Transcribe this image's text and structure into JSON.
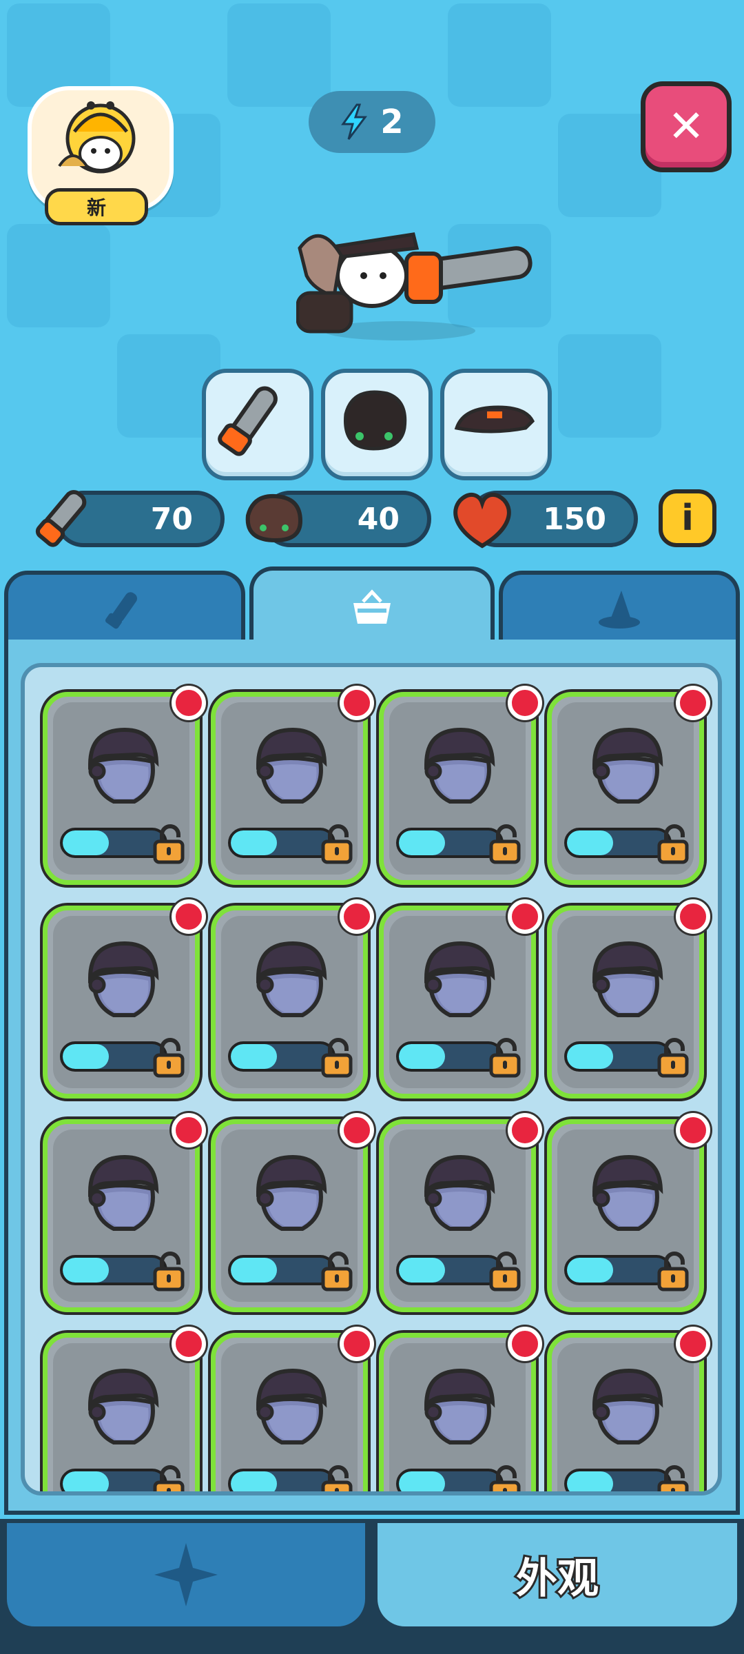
{
  "header": {
    "avatar_badge": "新",
    "energy_count": "2"
  },
  "stats": {
    "attack": "70",
    "defense": "40",
    "health": "150"
  },
  "tabs": [
    {
      "icon": "chainsaw-icon",
      "active": false
    },
    {
      "icon": "basket-icon",
      "active": true
    },
    {
      "icon": "hat-icon",
      "active": false
    }
  ],
  "items": {
    "rows": 4,
    "cols": 4,
    "progress": 0.45,
    "new_indicator": true
  },
  "bottom_nav": {
    "left_icon": "sparkle-icon",
    "right_label": "外观"
  },
  "colors": {
    "background": "#56c8ee",
    "panel": "#6fc6e6",
    "card_border": "#7fe23a",
    "progress": "#5fe6f4",
    "close": "#e84d7b",
    "info": "#ffc928"
  }
}
